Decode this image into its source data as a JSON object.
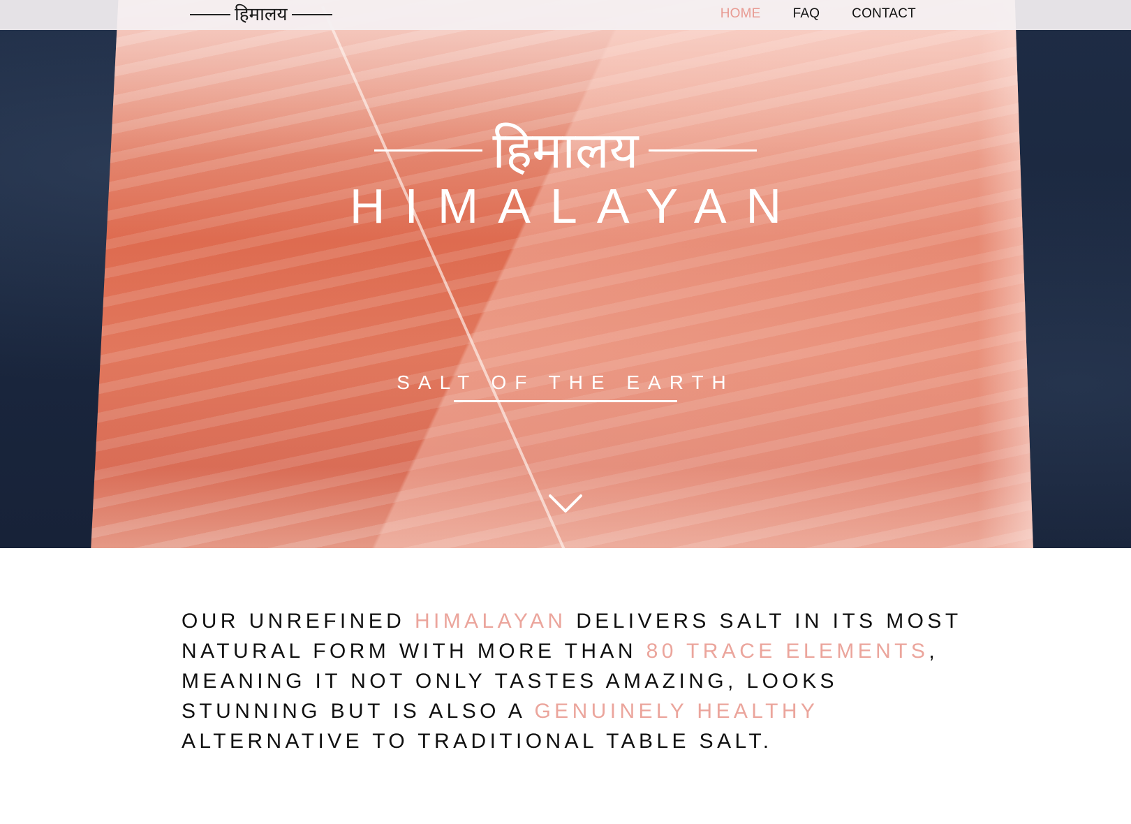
{
  "nav": {
    "brand_text": "हिमालय",
    "links": [
      {
        "label": "HOME",
        "active": true
      },
      {
        "label": "FAQ",
        "active": false
      },
      {
        "label": "CONTACT",
        "active": false
      }
    ]
  },
  "hero": {
    "devanagari": "हिमालय",
    "title": "HIMALAYAN",
    "tagline": "SALT OF THE EARTH",
    "scroll_icon": "chevron-down-icon"
  },
  "intro": {
    "segments": [
      {
        "text": "OUR UNREFINED ",
        "highlight": false
      },
      {
        "text": "HIMALAYAN",
        "highlight": true
      },
      {
        "text": " DELIVERS SALT IN ITS MOST NATURAL FORM WITH MORE THAN ",
        "highlight": false
      },
      {
        "text": "80 TRACE ELEMENTS",
        "highlight": true
      },
      {
        "text": ", MEANING IT NOT ONLY TASTES AMAZING, LOOKS STUNNING BUT IS ALSO A ",
        "highlight": false
      },
      {
        "text": "GENUINELY HEALTHY",
        "highlight": true
      },
      {
        "text": " ALTERNATIVE TO TRADITIONAL TABLE SALT.",
        "highlight": false
      }
    ]
  },
  "colors": {
    "accent": "#eba59c",
    "nav_active": "#e89a92",
    "text": "#111111"
  }
}
